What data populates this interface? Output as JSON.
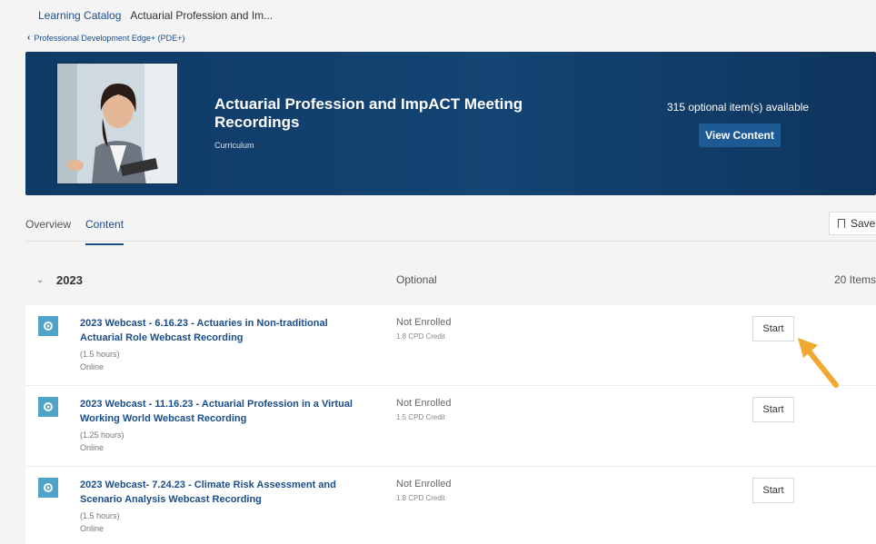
{
  "breadcrumb": {
    "root": "Learning Catalog",
    "current": "Actuarial Profession and Im..."
  },
  "back_link": "Professional Development Edge+ (PDE+)",
  "hero": {
    "title": "Actuarial Profession and ImpACT Meeting Recordings",
    "type": "Curriculum",
    "available": "315 optional item(s) available",
    "view_button": "View Content"
  },
  "tabs": [
    {
      "label": "Overview"
    },
    {
      "label": "Content"
    }
  ],
  "save_label": "Save",
  "section": {
    "year": "2023",
    "requirement": "Optional",
    "count": "20 Items"
  },
  "items": [
    {
      "title": "2023 Webcast - 6.16.23 - Actuaries in Non-traditional Actuarial Role Webcast Recording",
      "hours": "(1.5 hours)",
      "mode": "Online",
      "status": "Not Enrolled",
      "credit": "1.8 CPD Credit",
      "action": "Start"
    },
    {
      "title": "2023 Webcast - 11.16.23 - Actuarial Profession in a Virtual Working World Webcast Recording",
      "hours": "(1.25 hours)",
      "mode": "Online",
      "status": "Not Enrolled",
      "credit": "1.5 CPD Credit",
      "action": "Start"
    },
    {
      "title": "2023 Webcast- 7.24.23 - Climate Risk Assessment and Scenario Analysis Webcast Recording",
      "hours": "(1.5 hours)",
      "mode": "Online",
      "status": "Not Enrolled",
      "credit": "1.8 CPD Credit",
      "action": "Start"
    }
  ],
  "colors": {
    "hero_bg": "#134473",
    "link": "#1a4e8a",
    "icon_bg": "#4fa3c8",
    "arrow": "#f0a830"
  }
}
